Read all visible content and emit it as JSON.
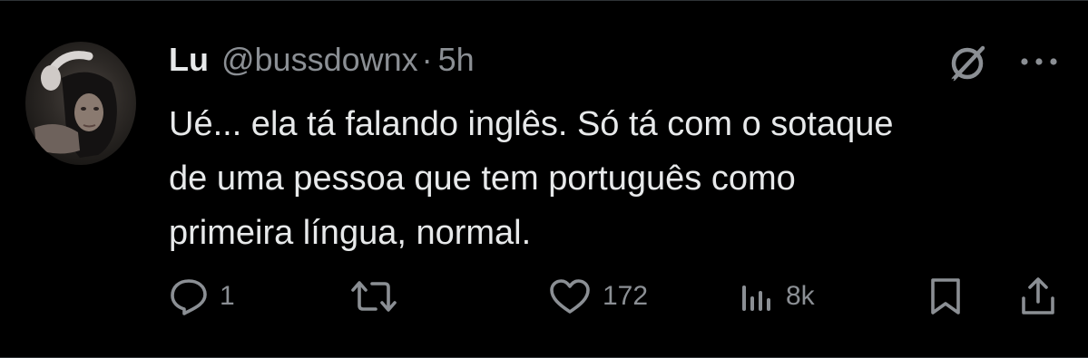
{
  "author": {
    "display_name": "Lu",
    "handle": "@bussdownx",
    "separator": "·",
    "time": "5h"
  },
  "tweet": {
    "lines": [
      "Ué... ela tá falando inglês. Só tá com o sotaque",
      "de uma pessoa que tem português como",
      "primeira língua, normal."
    ]
  },
  "actions": {
    "reply_count": "1",
    "retweet_count": "",
    "like_count": "172",
    "views_count": "8k"
  },
  "icons": {
    "grok": "grok-icon",
    "more": "more-icon",
    "reply": "reply-icon",
    "retweet": "retweet-icon",
    "like": "heart-icon",
    "views": "views-icon",
    "bookmark": "bookmark-icon",
    "share": "share-icon"
  },
  "colors": {
    "background": "#000000",
    "text": "#e7e9ea",
    "muted": "#8b8f94"
  }
}
